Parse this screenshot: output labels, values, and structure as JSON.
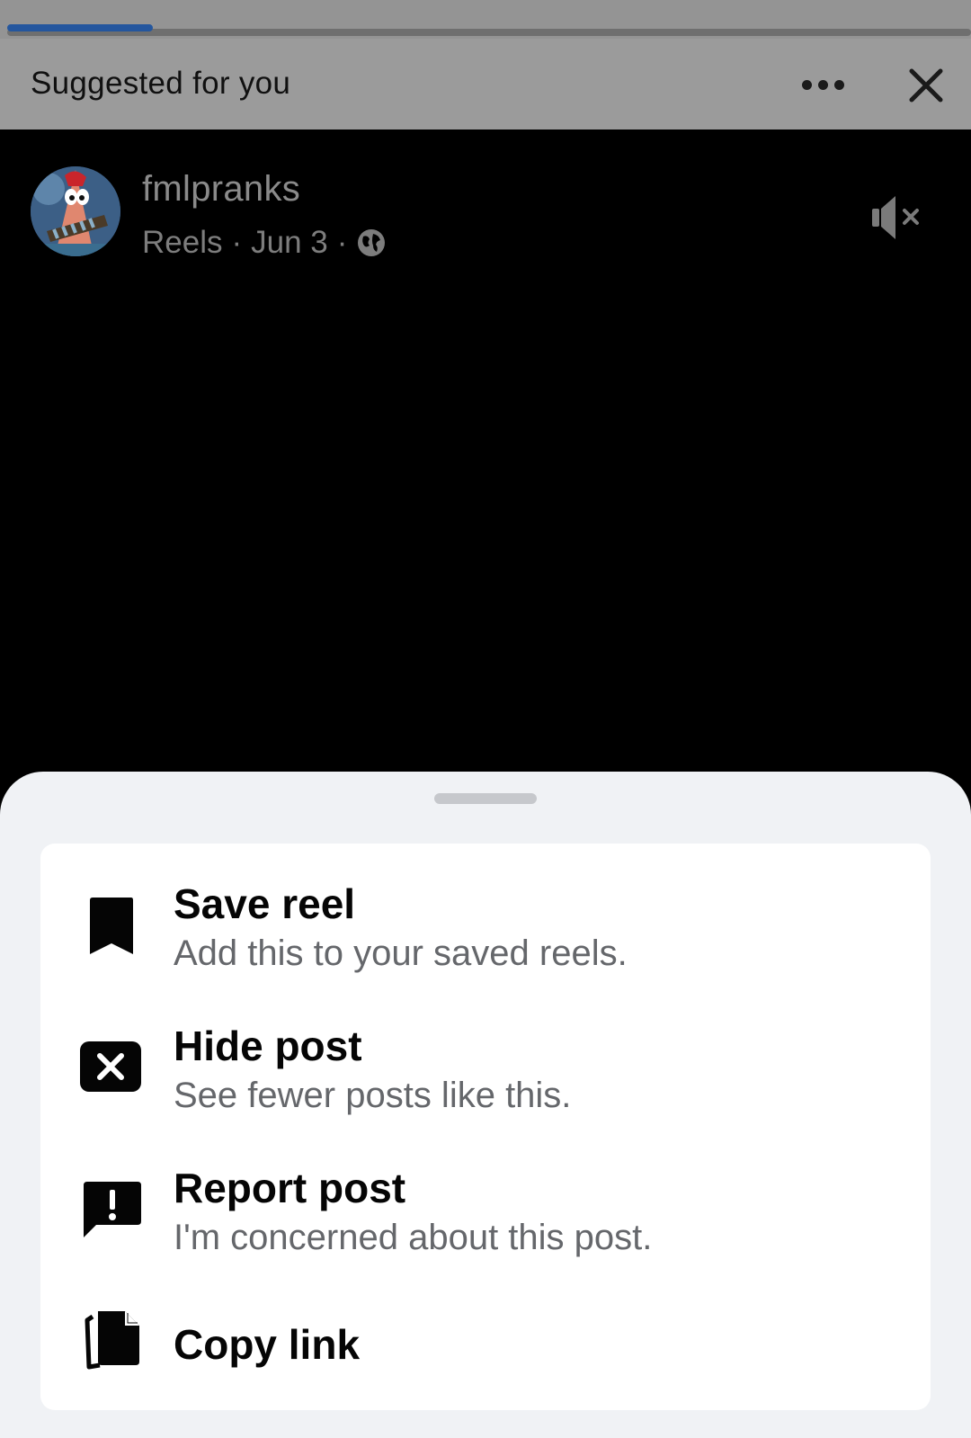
{
  "header": {
    "title": "Suggested for you",
    "more_icon": "more-horizontal-icon",
    "close_icon": "close-icon",
    "story_progress": 0.15
  },
  "reel": {
    "author": "fmlpranks",
    "meta_source": "Reels",
    "meta_separator": "·",
    "meta_date": "Jun 3",
    "audience_icon": "globe-icon",
    "sound_icon": "speaker-muted-icon"
  },
  "sheet": {
    "items": [
      {
        "icon": "bookmark-icon",
        "label": "Save reel",
        "sub": "Add this to your saved reels."
      },
      {
        "icon": "hide-x-box-icon",
        "label": "Hide post",
        "sub": "See fewer posts like this."
      },
      {
        "icon": "report-flag-icon",
        "label": "Report post",
        "sub": "I'm concerned about this post."
      },
      {
        "icon": "copy-link-icon",
        "label": "Copy link",
        "sub": ""
      }
    ]
  },
  "colors": {
    "progress_fill": "#24569e",
    "sheet_bg": "#f0f2f5",
    "card_bg": "#ffffff",
    "primary_text": "#050505",
    "secondary_text": "#65676b"
  }
}
